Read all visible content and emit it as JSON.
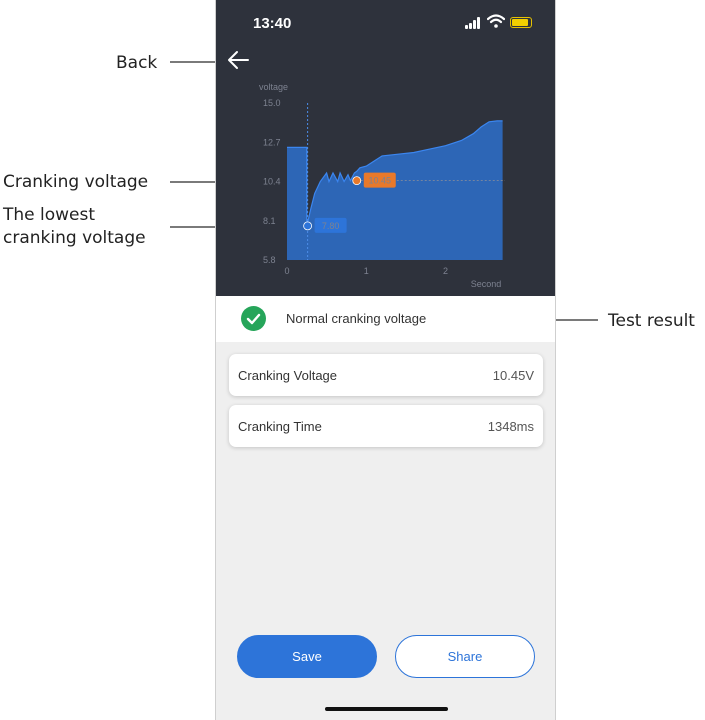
{
  "callouts": {
    "back": "Back",
    "cranking_voltage": "Cranking voltage",
    "lowest_line1": "The lowest",
    "lowest_line2": "cranking voltage",
    "test_result": "Test result"
  },
  "status_bar": {
    "time": "13:40",
    "icons": [
      "signal-icon",
      "wifi-icon",
      "battery-icon"
    ],
    "battery_color": "#f2cf00"
  },
  "chart_data": {
    "type": "area",
    "ylabel": "voltage",
    "xlabel": "Second",
    "y_ticks": [
      "15.0",
      "12.7",
      "10.4",
      "8.1",
      "5.8"
    ],
    "x_ticks": [
      "0",
      "1",
      "2"
    ],
    "ylim": [
      5.8,
      15.0
    ],
    "xlim": [
      0,
      2.75
    ],
    "grid": false,
    "color": "#2d74d9",
    "series": [
      {
        "x": [
          0.0,
          0.25,
          0.25,
          0.3,
          0.35,
          0.42,
          0.5,
          0.53,
          0.58,
          0.64,
          0.67,
          0.72,
          0.77,
          0.8,
          0.85,
          0.88,
          0.92,
          1.0,
          1.1,
          1.2,
          1.4,
          1.6,
          1.8,
          2.0,
          2.2,
          2.35,
          2.45,
          2.55,
          2.65,
          2.72
        ],
        "y": [
          12.4,
          12.4,
          7.8,
          8.8,
          9.7,
          10.4,
          10.9,
          10.4,
          10.9,
          10.4,
          10.9,
          10.4,
          10.8,
          10.45,
          10.9,
          11.0,
          11.2,
          11.3,
          11.6,
          11.9,
          12.0,
          12.1,
          12.3,
          12.5,
          12.8,
          13.2,
          13.6,
          13.9,
          13.95,
          13.95
        ]
      }
    ],
    "annotations": [
      {
        "label": "10.45",
        "x": 0.88,
        "y": 10.45,
        "color": "#e8792a"
      },
      {
        "label": "7.80",
        "x": 0.26,
        "y": 7.8,
        "color": "#2d74d9"
      }
    ],
    "marker_x": 0.26
  },
  "result": {
    "text": "Normal cranking voltage",
    "color": "#26a55a"
  },
  "metrics": [
    {
      "label": "Cranking Voltage",
      "value": "10.45V"
    },
    {
      "label": "Cranking Time",
      "value": "1348ms"
    }
  ],
  "buttons": {
    "save": "Save",
    "share": "Share"
  }
}
